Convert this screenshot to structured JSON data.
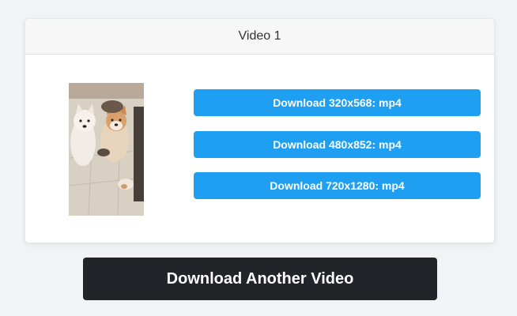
{
  "card": {
    "title": "Video 1",
    "thumbnail_icon": "video-thumbnail-two-dogs",
    "download_buttons": [
      {
        "label": "Download 320x568: mp4"
      },
      {
        "label": "Download 480x852: mp4"
      },
      {
        "label": "Download 720x1280: mp4"
      }
    ]
  },
  "another_button": {
    "label": "Download Another Video"
  },
  "colors": {
    "primary": "#1e9ff2",
    "dark_button": "#212529",
    "background": "#f2f3f5"
  }
}
